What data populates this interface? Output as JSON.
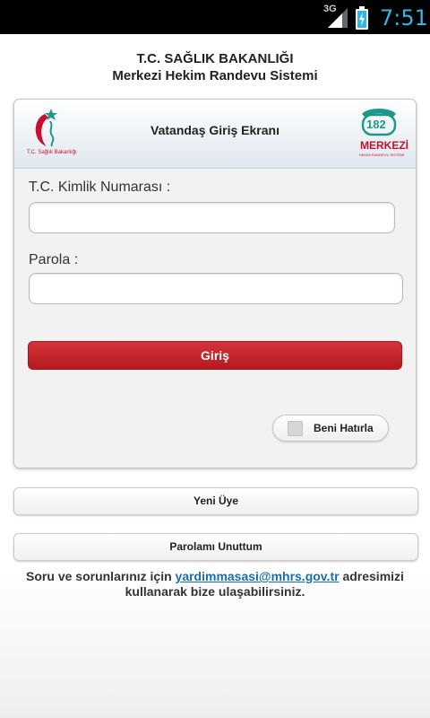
{
  "status_bar": {
    "network": "3G",
    "time": "7:51",
    "icons": [
      "signal-icon",
      "battery-icon"
    ]
  },
  "header": {
    "ministry": "T.C. SAĞLIK BAKANLIĞI",
    "system": "Merkezi Hekim Randevu Sistemi"
  },
  "login_card": {
    "title": "Vatandaş Giriş Ekranı",
    "left_logo_caption": "T.C. Sağlık Bakanlığı",
    "right_logo_number": "182",
    "right_logo_text": "MERKEZİ",
    "right_logo_subtext": "HEKİM RANDEVU SİSTEMİ",
    "tc_label": "T.C. Kimlik Numarası :",
    "tc_value": "",
    "password_label": "Parola :",
    "password_value": "",
    "login_button": "Giriş",
    "remember_label": "Beni Hatırla",
    "remember_checked": false
  },
  "actions": {
    "new_member": "Yeni Üye",
    "forgot_password": "Parolamı Unuttum"
  },
  "footer": {
    "text_before": "Soru ve sorunlarınız için ",
    "email": "yardimmasasi@mhrs.gov.tr",
    "text_after": " adresimizi kullanarak bize ulaşabilirsiniz."
  },
  "colors": {
    "accent_red": "#c8102e",
    "teal": "#1a9a8c",
    "clock_blue": "#33b5e5",
    "link_blue": "#1a6ea8"
  }
}
